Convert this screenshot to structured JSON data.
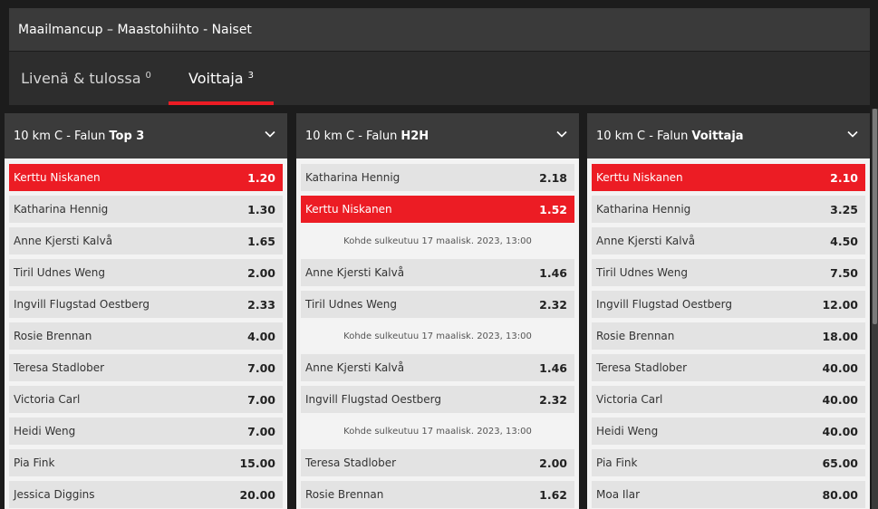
{
  "header": {
    "title": "Maailmancup – Maastohiihto - Naiset"
  },
  "tabs": [
    {
      "label": "Livenä & tulossa",
      "count": "0"
    },
    {
      "label": "Voittaja",
      "count": "3"
    }
  ],
  "markets": [
    {
      "title_prefix": "10 km C - Falun",
      "title_bold": "Top 3",
      "rows": [
        {
          "name": "Kerttu Niskanen",
          "odds": "1.20"
        },
        {
          "name": "Katharina Hennig",
          "odds": "1.30"
        },
        {
          "name": "Anne Kjersti Kalvå",
          "odds": "1.65"
        },
        {
          "name": "Tiril Udnes Weng",
          "odds": "2.00"
        },
        {
          "name": "Ingvill Flugstad Oestberg",
          "odds": "2.33"
        },
        {
          "name": "Rosie Brennan",
          "odds": "4.00"
        },
        {
          "name": "Teresa Stadlober",
          "odds": "7.00"
        },
        {
          "name": "Victoria Carl",
          "odds": "7.00"
        },
        {
          "name": "Heidi Weng",
          "odds": "7.00"
        },
        {
          "name": "Pia Fink",
          "odds": "15.00"
        },
        {
          "name": "Jessica Diggins",
          "odds": "20.00"
        }
      ]
    },
    {
      "title_prefix": "10 km C - Falun",
      "title_bold": "H2H",
      "rows": [
        {
          "name": "Katharina Hennig",
          "odds": "2.18"
        },
        {
          "name": "Kerttu Niskanen",
          "odds": "1.52"
        },
        {
          "note": "Kohde sulkeutuu 17 maalisk. 2023, 13:00"
        },
        {
          "name": "Anne Kjersti Kalvå",
          "odds": "1.46"
        },
        {
          "name": "Tiril Udnes Weng",
          "odds": "2.32"
        },
        {
          "note": "Kohde sulkeutuu 17 maalisk. 2023, 13:00"
        },
        {
          "name": "Anne Kjersti Kalvå",
          "odds": "1.46"
        },
        {
          "name": "Ingvill Flugstad Oestberg",
          "odds": "2.32"
        },
        {
          "note": "Kohde sulkeutuu 17 maalisk. 2023, 13:00"
        },
        {
          "name": "Teresa Stadlober",
          "odds": "2.00"
        },
        {
          "name": "Rosie Brennan",
          "odds": "1.62"
        }
      ]
    },
    {
      "title_prefix": "10 km C - Falun",
      "title_bold": "Voittaja",
      "rows": [
        {
          "name": "Kerttu Niskanen",
          "odds": "2.10"
        },
        {
          "name": "Katharina Hennig",
          "odds": "3.25"
        },
        {
          "name": "Anne Kjersti Kalvå",
          "odds": "4.50"
        },
        {
          "name": "Tiril Udnes Weng",
          "odds": "7.50"
        },
        {
          "name": "Ingvill Flugstad Oestberg",
          "odds": "12.00"
        },
        {
          "name": "Rosie Brennan",
          "odds": "18.00"
        },
        {
          "name": "Teresa Stadlober",
          "odds": "40.00"
        },
        {
          "name": "Victoria Carl",
          "odds": "40.00"
        },
        {
          "name": "Heidi Weng",
          "odds": "40.00"
        },
        {
          "name": "Pia Fink",
          "odds": "65.00"
        },
        {
          "name": "Moa Ilar",
          "odds": "80.00"
        }
      ]
    }
  ],
  "colors": {
    "accent": "#ec1c24",
    "panel": "#3b3b3b",
    "row": "#e3e3e3"
  }
}
